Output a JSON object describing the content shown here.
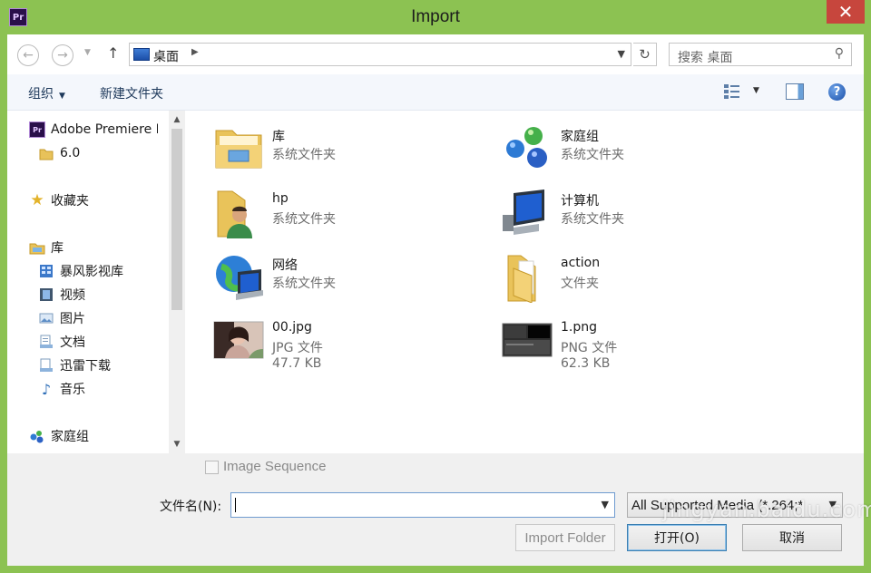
{
  "window": {
    "title": "Import",
    "app_icon_text": "Pr"
  },
  "address": {
    "path": "桌面",
    "search_placeholder": "搜索 桌面"
  },
  "toolbar": {
    "organize": "组织",
    "new_folder": "新建文件夹"
  },
  "nav": {
    "items": [
      {
        "label": "Adobe Premiere Pro",
        "icon": "premiere-icon"
      },
      {
        "label": "6.0",
        "icon": "folder-icon"
      },
      {
        "label": "收藏夹",
        "icon": "star-icon"
      },
      {
        "label": "库",
        "icon": "library-icon"
      },
      {
        "label": "暴风影视库",
        "icon": "video-library-icon"
      },
      {
        "label": "视频",
        "icon": "videos-icon"
      },
      {
        "label": "图片",
        "icon": "pictures-icon"
      },
      {
        "label": "文档",
        "icon": "documents-icon"
      },
      {
        "label": "迅雷下载",
        "icon": "downloads-icon"
      },
      {
        "label": "音乐",
        "icon": "music-icon"
      },
      {
        "label": "家庭组",
        "icon": "homegroup-icon"
      }
    ]
  },
  "files": [
    {
      "name": "库",
      "type": "系统文件夹",
      "icon": "libraries-folder-icon"
    },
    {
      "name": "家庭组",
      "type": "系统文件夹",
      "icon": "homegroup-icon"
    },
    {
      "name": "hp",
      "type": "系统文件夹",
      "icon": "user-folder-icon"
    },
    {
      "name": "计算机",
      "type": "系统文件夹",
      "icon": "computer-icon"
    },
    {
      "name": "网络",
      "type": "系统文件夹",
      "icon": "network-icon"
    },
    {
      "name": "action",
      "type": "文件夹",
      "icon": "folder-icon"
    },
    {
      "name": "00.jpg",
      "type": "JPG 文件",
      "size": "47.7 KB",
      "icon": "image-thumbnail"
    },
    {
      "name": "1.png",
      "type": "PNG 文件",
      "size": "62.3 KB",
      "icon": "image-thumbnail"
    }
  ],
  "bottom": {
    "image_sequence": "Image Sequence",
    "filename_label": "文件名(N):",
    "filename_value": "",
    "file_type": "All Supported Media (*.264;*",
    "import_folder": "Import Folder",
    "open": "打开(O)",
    "cancel": "取消"
  },
  "watermark": "jingyan.baidu.com",
  "colors": {
    "frame": "#8cc252",
    "close": "#c7463d",
    "toolbar": "#f4f7fc",
    "bottom_panel": "#f0f0f0"
  }
}
